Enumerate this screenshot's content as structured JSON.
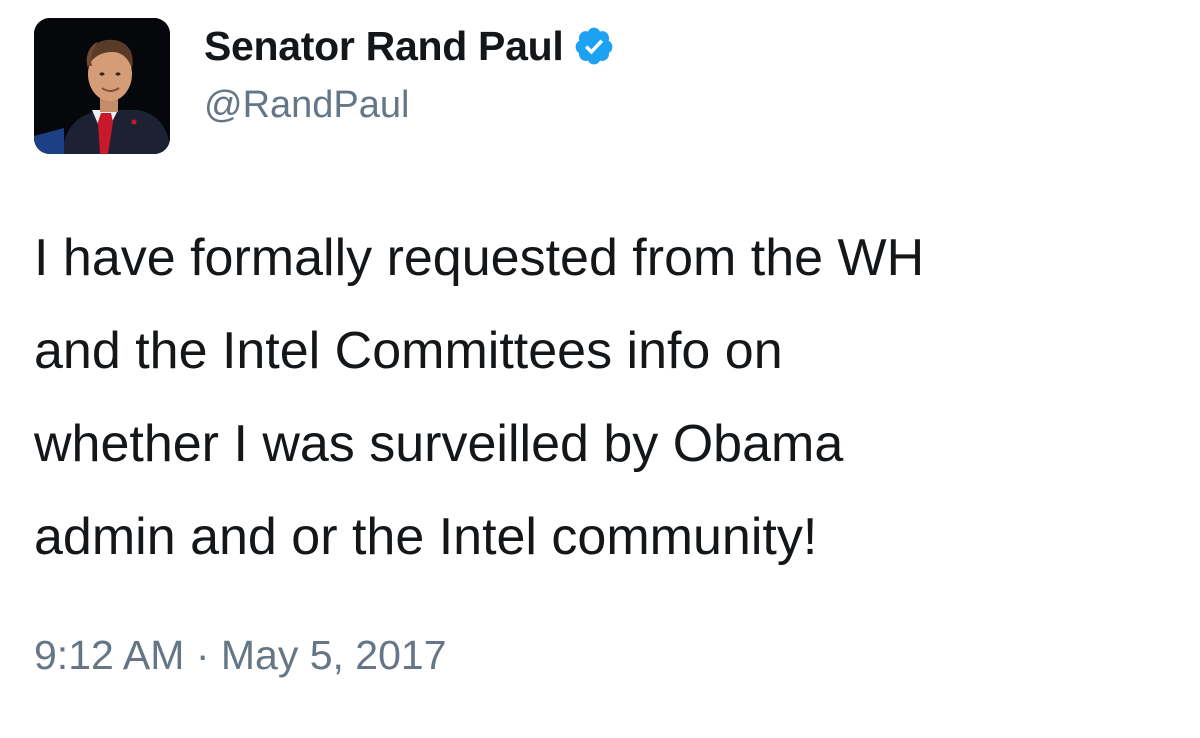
{
  "author": {
    "display_name": "Senator Rand Paul",
    "handle": "@RandPaul",
    "verified": true,
    "verified_icon": "verified-badge-icon",
    "avatar_icon": "profile-photo"
  },
  "tweet": {
    "lines": [
      "I have formally requested from the WH",
      "and the Intel Committees info on",
      "whether I was surveilled by Obama",
      "admin and or the Intel community!"
    ],
    "timestamp": "9:12 AM · May 5, 2017"
  },
  "colors": {
    "text": "#14171a",
    "secondary": "#657786",
    "verified": "#1da1f2",
    "background": "#ffffff"
  }
}
